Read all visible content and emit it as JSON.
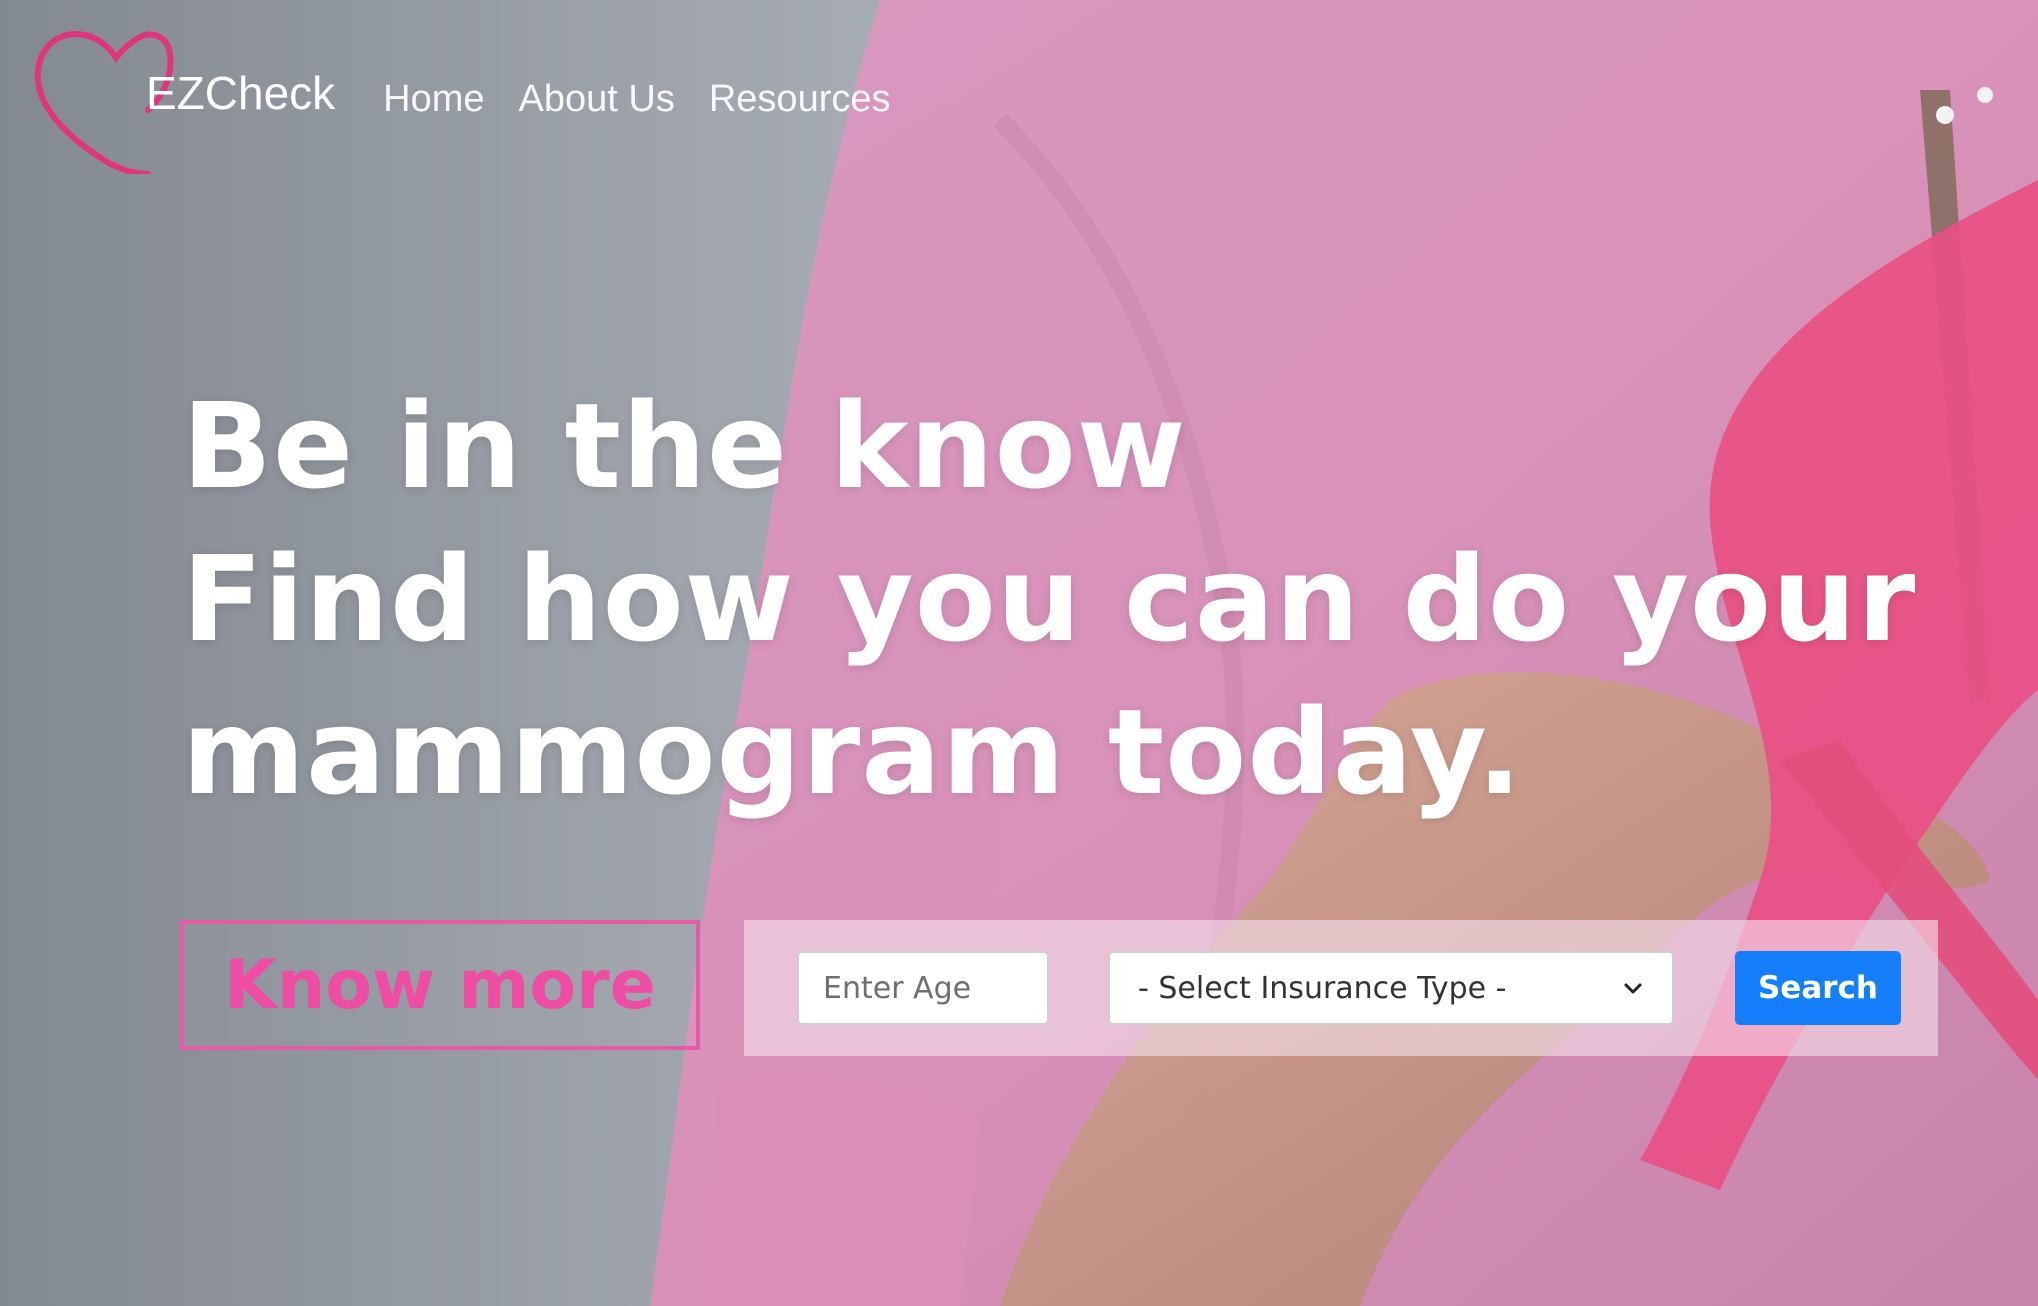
{
  "brand": {
    "name": "EZCheck",
    "logo_icon": "heart-outline-icon",
    "logo_color": "#e0357d"
  },
  "nav": {
    "items": [
      {
        "label": "Home"
      },
      {
        "label": "About Us"
      },
      {
        "label": "Resources"
      }
    ]
  },
  "hero": {
    "headline_lines": [
      "Be in the know",
      "Find how you can do your",
      "mammogram today."
    ],
    "know_more_label": "Know more"
  },
  "search": {
    "age_placeholder": "Enter Age",
    "age_value": "",
    "insurance_selected": "- Select Insurance Type -",
    "button_label": "Search"
  },
  "colors": {
    "accent_pink": "#ef4da3",
    "search_blue": "#157efb",
    "ribbon_pink": "#e8477f",
    "shirt_pink": "#d98db6"
  }
}
